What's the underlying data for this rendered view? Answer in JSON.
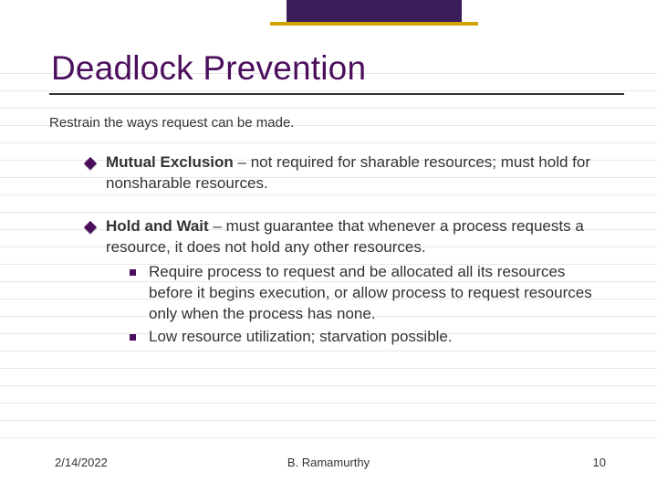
{
  "title": "Deadlock Prevention",
  "subtitle": "Restrain the ways request can be made.",
  "bullets": [
    {
      "bold": "Mutual Exclusion",
      "rest": " – not required for sharable resources; must hold for nonsharable resources.",
      "subs": []
    },
    {
      "bold": "Hold and Wait",
      "rest": " – must guarantee that whenever a process requests a resource, it does not hold any other resources.",
      "subs": [
        "Require process to request and be allocated all its resources before it begins execution, or allow process to request resources only when the process has none.",
        "Low resource utilization; starvation possible."
      ]
    }
  ],
  "footer": {
    "date": "2/14/2022",
    "author": "B. Ramamurthy",
    "page": "10"
  }
}
